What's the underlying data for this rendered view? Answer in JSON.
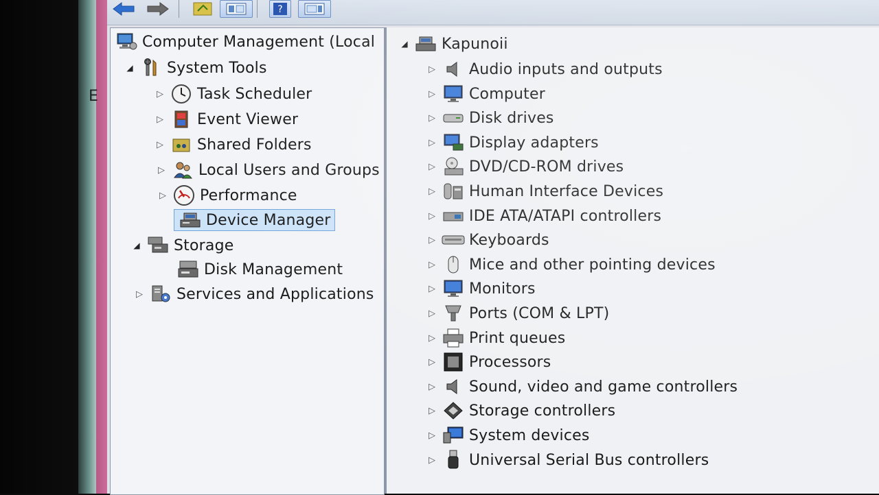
{
  "left_tree": {
    "root": {
      "label": "Computer Management (Local",
      "icon": "computer-management-icon"
    },
    "system_tools": {
      "label": "System Tools",
      "icon": "tools-icon",
      "children": [
        {
          "label": "Task Scheduler",
          "icon": "clock-icon"
        },
        {
          "label": "Event Viewer",
          "icon": "event-viewer-icon"
        },
        {
          "label": "Shared Folders",
          "icon": "shared-folder-icon"
        },
        {
          "label": "Local Users and Groups",
          "icon": "users-icon"
        },
        {
          "label": "Performance",
          "icon": "performance-gauge-icon"
        },
        {
          "label": "Device Manager",
          "icon": "device-manager-icon",
          "selected": true
        }
      ]
    },
    "storage": {
      "label": "Storage",
      "icon": "storage-icon",
      "children": [
        {
          "label": "Disk Management",
          "icon": "disk-management-icon"
        }
      ]
    },
    "services": {
      "label": "Services and Applications",
      "icon": "services-icon"
    }
  },
  "device_tree": {
    "root": {
      "label": "Kapunoii",
      "icon": "computer-root-icon"
    },
    "categories": [
      {
        "label": "Audio inputs and outputs",
        "icon": "speaker-icon"
      },
      {
        "label": "Computer",
        "icon": "monitor-icon"
      },
      {
        "label": "Disk drives",
        "icon": "disk-drive-icon"
      },
      {
        "label": "Display adapters",
        "icon": "display-adapter-icon"
      },
      {
        "label": "DVD/CD-ROM drives",
        "icon": "dvd-drive-icon"
      },
      {
        "label": "Human Interface Devices",
        "icon": "hid-icon"
      },
      {
        "label": "IDE ATA/ATAPI controllers",
        "icon": "ide-controller-icon"
      },
      {
        "label": "Keyboards",
        "icon": "keyboard-icon"
      },
      {
        "label": "Mice and other pointing devices",
        "icon": "mouse-icon"
      },
      {
        "label": "Monitors",
        "icon": "monitor-icon"
      },
      {
        "label": "Ports (COM & LPT)",
        "icon": "port-icon"
      },
      {
        "label": "Print queues",
        "icon": "printer-icon"
      },
      {
        "label": "Processors",
        "icon": "processor-icon"
      },
      {
        "label": "Sound, video and game controllers",
        "icon": "speaker-icon"
      },
      {
        "label": "Storage controllers",
        "icon": "storage-controller-icon"
      },
      {
        "label": "System devices",
        "icon": "system-devices-icon"
      },
      {
        "label": "Universal Serial Bus controllers",
        "icon": "usb-icon"
      }
    ]
  },
  "stray_char": "E"
}
